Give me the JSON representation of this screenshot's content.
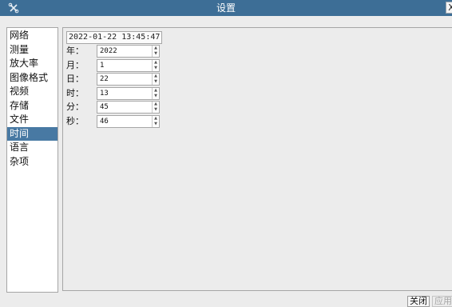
{
  "window": {
    "title": "设置",
    "app_icon": "settings-app-icon",
    "close_glyph": "X",
    "accent": "#3d6e96"
  },
  "sidebar": {
    "selected_index": 7,
    "selected_color": "#4879a3",
    "items": [
      {
        "label": "网络"
      },
      {
        "label": "测量"
      },
      {
        "label": "放大率"
      },
      {
        "label": "图像格式"
      },
      {
        "label": "视频"
      },
      {
        "label": "存储"
      },
      {
        "label": "文件"
      },
      {
        "label": "时间"
      },
      {
        "label": "语言"
      },
      {
        "label": "杂项"
      }
    ]
  },
  "time_panel": {
    "datetime": "2022-01-22 13:45:47",
    "fields": [
      {
        "label": "年：",
        "value": "2022"
      },
      {
        "label": "月：",
        "value": "1"
      },
      {
        "label": "日：",
        "value": "22"
      },
      {
        "label": "时：",
        "value": "13"
      },
      {
        "label": "分：",
        "value": "45"
      },
      {
        "label": "秒：",
        "value": "46"
      }
    ]
  },
  "buttons": {
    "close": "关闭",
    "apply": "应用"
  }
}
